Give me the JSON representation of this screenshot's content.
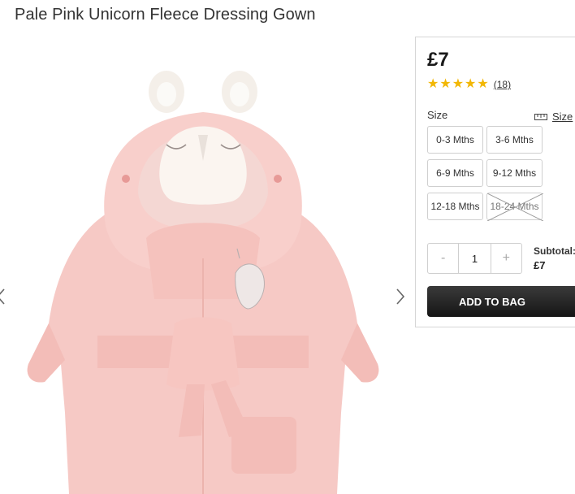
{
  "product": {
    "title": "Pale Pink Unicorn Fleece Dressing Gown",
    "price": "£7",
    "rating": {
      "stars": 5,
      "review_count": "(18)"
    }
  },
  "size": {
    "label": "Size",
    "guide_label": "Size",
    "options": [
      {
        "label": "0-3 Mths",
        "available": true
      },
      {
        "label": "3-6 Mths",
        "available": true
      },
      {
        "label": "6-9 Mths",
        "available": true
      },
      {
        "label": "9-12 Mths",
        "available": true
      },
      {
        "label": "12-18 Mths",
        "available": true
      },
      {
        "label": "18-24 Mths",
        "available": false
      }
    ]
  },
  "quantity": {
    "minus": "-",
    "value": "1",
    "plus": "+"
  },
  "subtotal": {
    "label": "Subtotal:",
    "value": "£7"
  },
  "actions": {
    "add_to_bag": "ADD TO BAG"
  },
  "carousel": {
    "prev_icon": "chevron-left-icon",
    "next_icon": "chevron-right-icon"
  },
  "colors": {
    "star": "#f2b705",
    "button": "#1e1e1e",
    "gown": "#f6c9c5"
  }
}
